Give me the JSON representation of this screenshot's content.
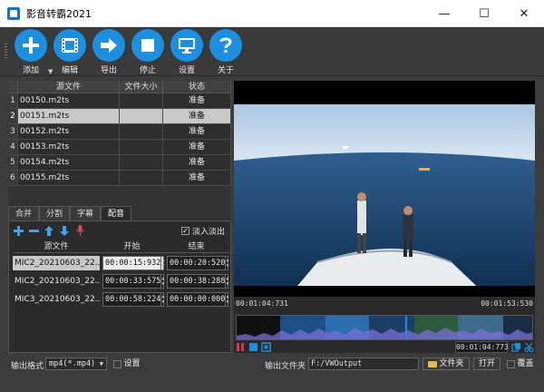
{
  "window": {
    "title": "影音转霸2021",
    "minimize": "—",
    "maximize": "☐",
    "close": "✕"
  },
  "toolbar": {
    "add": "添加",
    "edit": "编辑",
    "export": "导出",
    "stop": "停止",
    "settings": "设置",
    "about": "关于"
  },
  "file_table": {
    "headers": {
      "source": "源文件",
      "size": "文件大小",
      "status": "状态"
    },
    "rows": [
      {
        "index": "1",
        "name": "00150.m2ts",
        "size": "",
        "status": "准备"
      },
      {
        "index": "2",
        "name": "00151.m2ts",
        "size": "",
        "status": "准备"
      },
      {
        "index": "3",
        "name": "00152.m2ts",
        "size": "",
        "status": "准备"
      },
      {
        "index": "4",
        "name": "00153.m2ts",
        "size": "",
        "status": "准备"
      },
      {
        "index": "5",
        "name": "00154.m2ts",
        "size": "",
        "status": "准备"
      },
      {
        "index": "6",
        "name": "00155.m2ts",
        "size": "",
        "status": "准备"
      }
    ]
  },
  "tabs": {
    "merge": "合并",
    "split": "分割",
    "subtitle": "字幕",
    "dubbing": "配音"
  },
  "dub_panel": {
    "fade_label": "淡入淡出",
    "fade_checked": true,
    "headers": {
      "source": "源文件",
      "start": "开始",
      "end": "结束"
    },
    "rows": [
      {
        "file": "MIC2_20210603_22...",
        "start": "00:00:15:932",
        "end": "00:00:20:520"
      },
      {
        "file": "MIC2_20210603_22...",
        "start": "00:00:33:575",
        "end": "00:00:38:288"
      },
      {
        "file": "MIC3_20210603_22...",
        "start": "00:00:58:224",
        "end": "00:00:00:000"
      }
    ]
  },
  "player": {
    "time_start": "00:01:04:731",
    "time_end": "00:01:53:530",
    "current_time": "00:01:04:773",
    "progress": 0.57
  },
  "bottom": {
    "format_label": "输出格式",
    "format_value": "mp4(*.mp4)",
    "settings_label": "设置",
    "output_folder_label": "输出文件夹",
    "output_path": "F:/VWOutput",
    "folder_button": "文件夹",
    "open_button": "打开",
    "overwrite_label": "覆盖"
  },
  "colors": {
    "accent": "#1d8fe0",
    "panel": "#2b2b2b",
    "background": "#3c3c3c"
  }
}
